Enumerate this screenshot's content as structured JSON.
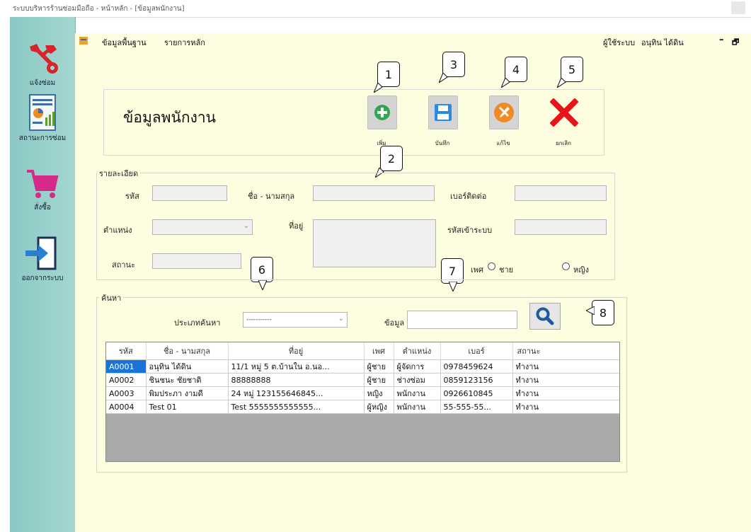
{
  "window": {
    "title": "ระบบบริหารร้านซ่อมมือถือ - หน้าหลัก - [ข้อมูลพนักงาน]"
  },
  "sidebar": {
    "items": [
      {
        "label": "แจ้งซ่อม",
        "icon": "repair-tools-icon"
      },
      {
        "label": "สถานะการซ่อม",
        "icon": "report-chart-icon"
      },
      {
        "label": "สั่งซื้อ",
        "icon": "shopping-cart-icon"
      },
      {
        "label": "ออกจากระบบ",
        "icon": "logout-door-icon"
      }
    ]
  },
  "menubar": {
    "items": [
      "ข้อมูลพื้นฐาน",
      "รายการหลัก"
    ],
    "user_label": "ผู้ใช้ระบบ",
    "user_name": "อนุทิน ได้ดิน",
    "minimize": "–",
    "restore": "🗗"
  },
  "page": {
    "title": "ข้อมูลพนักงาน"
  },
  "toolbar": {
    "add": "เพิ่ม",
    "save": "บันทึก",
    "edit": "แก้ไข",
    "cancel": "ยกเลิก"
  },
  "callouts": [
    "1",
    "2",
    "3",
    "4",
    "5",
    "6",
    "7",
    "8"
  ],
  "details": {
    "group_title": "รายละเอียด",
    "code_label": "รหัส",
    "name_label": "ชื่อ - นามสกุล",
    "phone_label": "เบอร์ติดต่อ",
    "position_label": "ตำแหน่ง",
    "address_label": "ที่อยู่",
    "password_label": "รหัสเข้าระบบ",
    "status_label": "สถานะ",
    "gender_label": "เพศ",
    "gender_male": "ชาย",
    "gender_female": "หญิง"
  },
  "search": {
    "group_title": "ค้นหา",
    "type_label": "ประเภทค้นหา",
    "type_value": "-----------",
    "data_label": "ข้อมูล",
    "data_value": ""
  },
  "table": {
    "columns": [
      "รหัส",
      "ชื่อ - นามสกุล",
      "ที่อยู่",
      "เพศ",
      "ตำแหน่ง",
      "เบอร์",
      "สถานะ"
    ],
    "rows": [
      [
        "A0001",
        "อนุทิน ได้ดิน",
        "11/1 หมู่ 5 ต.บ้านใน อ.นอ...",
        "ผู้ชาย",
        "ผู้จัดการ",
        "0978459624",
        "ทำงาน"
      ],
      [
        "A0002",
        "ชินชนะ ชัยชาติ",
        "88888888",
        "ผู้ชาย",
        "ช่างซ่อม",
        "0859123156",
        "ทำงาน"
      ],
      [
        "A0003",
        "พิมประภา งามดี",
        "24 หมู่ 123155646845...",
        "หญิง",
        "พนักงาน",
        "0926610845",
        "ทำงาน"
      ],
      [
        "A0004",
        "Test 01",
        "Test 5555555555555...",
        "ผู้หญิง",
        "พนักงาน",
        "55-555-55...",
        "ทำงาน"
      ]
    ]
  }
}
